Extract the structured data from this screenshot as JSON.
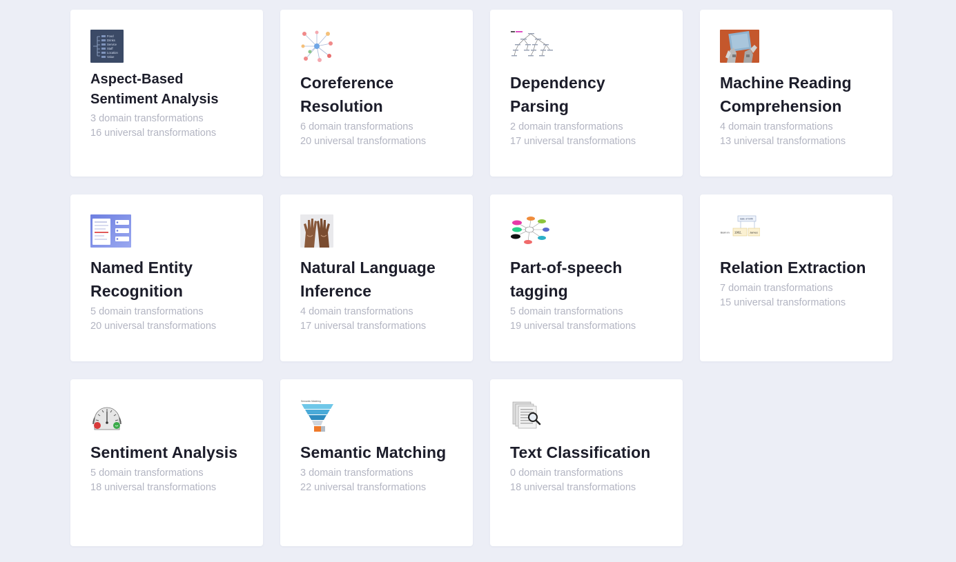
{
  "cards": [
    {
      "title": "Aspect-Based Sentiment Analysis",
      "domain": "3 domain transformations",
      "universal": "16 universal transformations",
      "icon": "absa-list-thumbnail"
    },
    {
      "title": "Coreference Resolution",
      "domain": "6 domain transformations",
      "universal": "20 universal transformations",
      "icon": "network-graph-thumbnail"
    },
    {
      "title": "Dependency Parsing",
      "domain": "2 domain transformations",
      "universal": "17 universal transformations",
      "icon": "parse-tree-thumbnail"
    },
    {
      "title": "Machine Reading Comprehension",
      "domain": "4 domain transformations",
      "universal": "13 universal transformations",
      "icon": "robot-reading-thumbnail"
    },
    {
      "title": "Named Entity Recognition",
      "domain": "5 domain transformations",
      "universal": "20 universal transformations",
      "icon": "ner-ui-thumbnail"
    },
    {
      "title": "Natural Language Inference",
      "domain": "4 domain transformations",
      "universal": "17 universal transformations",
      "icon": "raised-hands-thumbnail"
    },
    {
      "title": "Part-of-speech tagging",
      "domain": "5 domain transformations",
      "universal": "19 universal transformations",
      "icon": "pos-bubbles-thumbnail"
    },
    {
      "title": "Relation Extraction",
      "domain": "7 domain transformations",
      "universal": "15 universal transformations",
      "icon": "relation-box-thumbnail"
    },
    {
      "title": "Sentiment Analysis",
      "domain": "5 domain transformations",
      "universal": "18 universal transformations",
      "icon": "sentiment-gauge-thumbnail"
    },
    {
      "title": "Semantic Matching",
      "domain": "3 domain transformations",
      "universal": "22 universal transformations",
      "icon": "funnel-thumbnail"
    },
    {
      "title": "Text Classification",
      "domain": "0 domain transformations",
      "universal": "18 universal transformations",
      "icon": "documents-magnifier-thumbnail"
    }
  ],
  "thumb_text": {
    "absa": [
      "Food",
      "Drinks",
      "Service",
      "Staff",
      "Location",
      "Value"
    ],
    "re_label": "date of birth",
    "re_prefix": "Born in",
    "re_year": "1962,",
    "re_suffix": "James",
    "sm_label": "Semantic Matching"
  }
}
